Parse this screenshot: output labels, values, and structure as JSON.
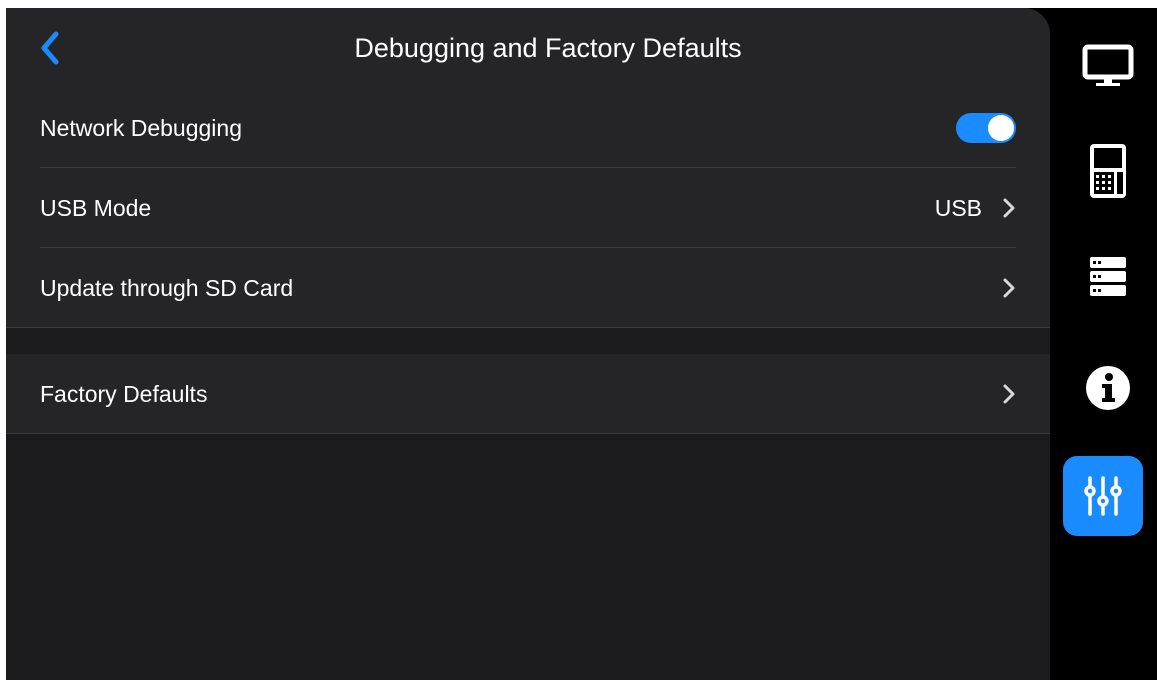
{
  "header": {
    "title": "Debugging and Factory Defaults",
    "back_icon": "chevron-left-icon",
    "accent_color": "#1a8cff"
  },
  "settings": {
    "network_debugging": {
      "label": "Network Debugging",
      "enabled": true
    },
    "usb_mode": {
      "label": "USB Mode",
      "value": "USB"
    },
    "sd_update": {
      "label": "Update through SD Card"
    },
    "factory_defaults": {
      "label": "Factory Defaults"
    }
  },
  "sidebar": {
    "items": [
      {
        "icon": "monitor-icon",
        "active": false
      },
      {
        "icon": "device-keypad-icon",
        "active": false
      },
      {
        "icon": "server-icon",
        "active": false
      },
      {
        "icon": "info-icon",
        "active": false
      },
      {
        "icon": "sliders-icon",
        "active": true
      }
    ]
  }
}
